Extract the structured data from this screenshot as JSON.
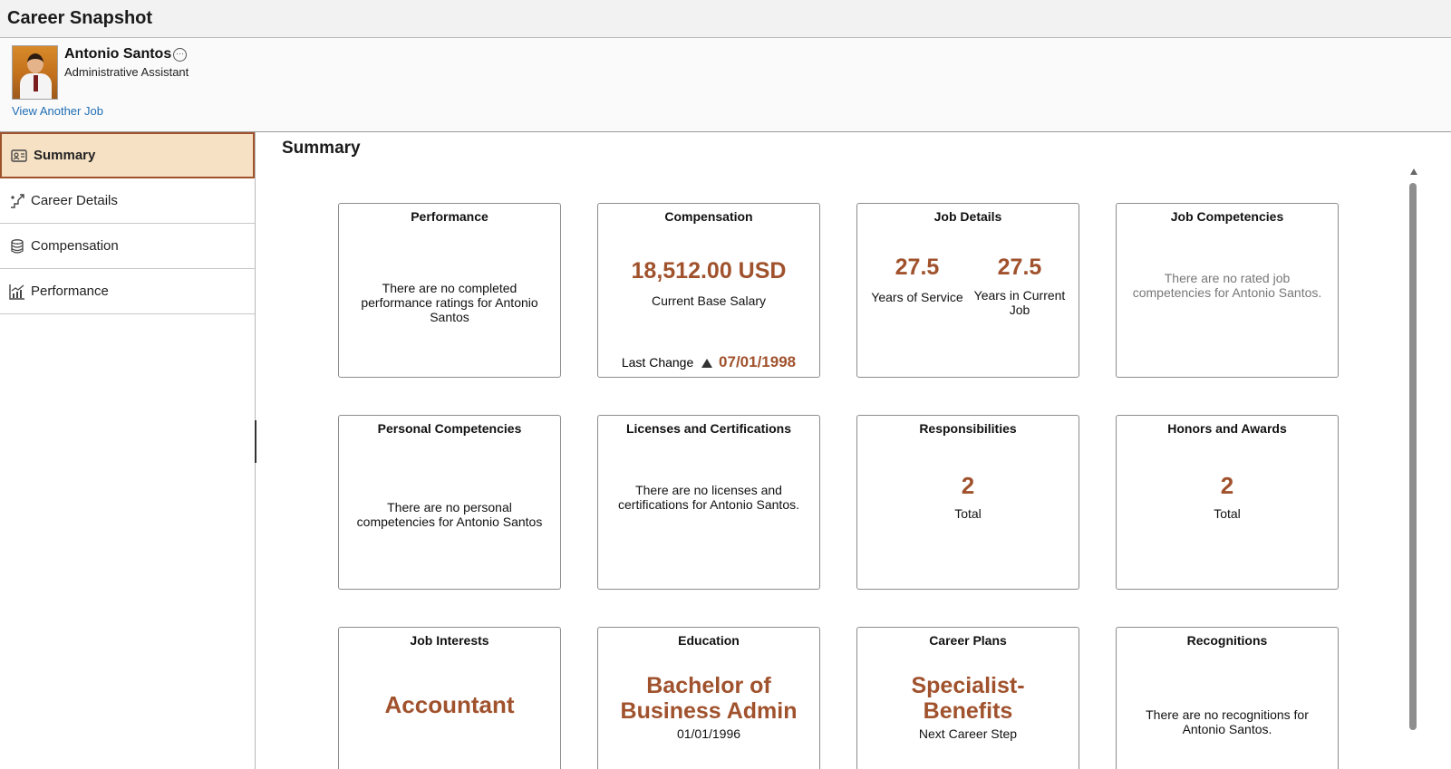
{
  "app": {
    "title": "Career Snapshot"
  },
  "profile": {
    "name": "Antonio Santos",
    "job_title": "Administrative Assistant",
    "view_another_job": "View Another Job",
    "more_icon": "ellipsis-circle-icon"
  },
  "sidebar": {
    "items": [
      {
        "label": "Summary",
        "icon": "profile-card-icon",
        "active": true
      },
      {
        "label": "Career Details",
        "icon": "career-steps-icon",
        "active": false
      },
      {
        "label": "Compensation",
        "icon": "coin-stack-icon",
        "active": false
      },
      {
        "label": "Performance",
        "icon": "performance-chart-icon",
        "active": false
      }
    ]
  },
  "main": {
    "title": "Summary",
    "tiles": {
      "performance": {
        "title": "Performance",
        "message": "There are no completed performance ratings for Antonio Santos"
      },
      "compensation": {
        "title": "Compensation",
        "amount": "18,512.00 USD",
        "amount_label": "Current Base Salary",
        "last_change_label": "Last Change",
        "last_change_date": "07/01/1998"
      },
      "job_details": {
        "title": "Job Details",
        "years_service": "27.5",
        "years_service_label": "Years of Service",
        "years_job": "27.5",
        "years_job_label": "Years in Current Job"
      },
      "job_competencies": {
        "title": "Job Competencies",
        "message": "There are no rated job competencies for Antonio Santos."
      },
      "personal_competencies": {
        "title": "Personal Competencies",
        "message": "There are no personal competencies for Antonio Santos"
      },
      "licenses": {
        "title": "Licenses and Certifications",
        "message": "There are no licenses and certifications for Antonio Santos."
      },
      "responsibilities": {
        "title": "Responsibilities",
        "count": "2",
        "count_label": "Total"
      },
      "honors": {
        "title": "Honors and Awards",
        "count": "2",
        "count_label": "Total"
      },
      "job_interests": {
        "title": "Job Interests",
        "value": "Accountant"
      },
      "education": {
        "title": "Education",
        "value": "Bachelor of Business Admin",
        "date": "01/01/1996"
      },
      "career_plans": {
        "title": "Career Plans",
        "value": "Specialist-Benefits",
        "label": "Next Career Step"
      },
      "recognitions": {
        "title": "Recognitions",
        "message": "There are no recognitions for Antonio Santos."
      }
    }
  },
  "colors": {
    "accent": "#a0522d",
    "active_bg": "#f6e1c4",
    "link": "#1f6db3"
  }
}
